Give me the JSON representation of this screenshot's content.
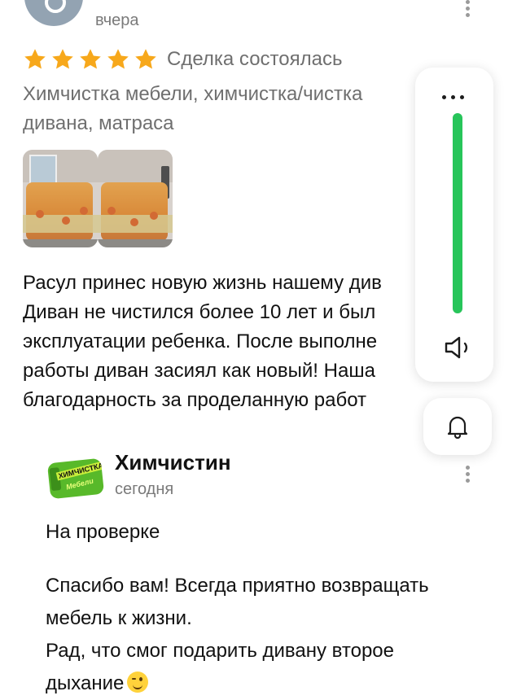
{
  "review": {
    "date": "вчера",
    "rating": 5,
    "deal_status": "Сделка состоялась",
    "service_lines": [
      "Химчистка мебели, химчистка/чистка",
      "дивана, матраса"
    ],
    "text_lines": [
      "Расул принес новую жизнь нашему див",
      "Диван не чистился более 10 лет и был",
      "эксплуатации ребенка. После выполне",
      "работы диван засиял как новый! Наша",
      "благодарность за проделанную работ"
    ]
  },
  "panel": {
    "volume_level": 1.0,
    "colors": {
      "volume_fill": "#27c55a",
      "star": "#f7a81b"
    },
    "icons": [
      "more-icon",
      "speaker-icon",
      "bell-icon"
    ]
  },
  "answer": {
    "company": "Химчистин",
    "logo_text": [
      "ХИМЧИСТКА",
      "Мебели"
    ],
    "date": "сегодня",
    "status": "На проверке",
    "text_lines": [
      "Спасибо вам! Всегда приятно возвращать",
      "мебель к жизни.",
      "Рад, что смог подарить дивану второе",
      "дыхание"
    ],
    "emoji": "wink-emoji"
  }
}
